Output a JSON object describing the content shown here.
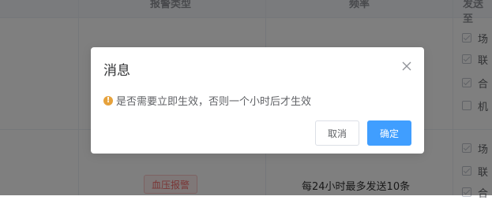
{
  "table": {
    "headers": [
      "报警类型",
      "频率",
      "发送至"
    ],
    "rows": [
      {
        "options": [
          {
            "label": "场",
            "checked": true
          },
          {
            "label": "联",
            "checked": true
          },
          {
            "label": "合",
            "checked": true
          },
          {
            "label": "机",
            "checked": false
          }
        ]
      },
      {
        "alarm_tag": "血压报警",
        "frequency": "每24小时最多发送10条",
        "options": [
          {
            "label": "场",
            "checked": true
          },
          {
            "label": "联",
            "checked": true
          },
          {
            "label": "合",
            "checked": true
          }
        ]
      }
    ]
  },
  "dialog": {
    "title": "消息",
    "message": "是否需要立即生效，否则一个小时后才生效",
    "warning_icon_glyph": "!",
    "cancel_label": "取消",
    "confirm_label": "确定"
  },
  "colors": {
    "primary": "#409eff",
    "warning": "#e6a23c",
    "danger": "#f56c6c"
  }
}
